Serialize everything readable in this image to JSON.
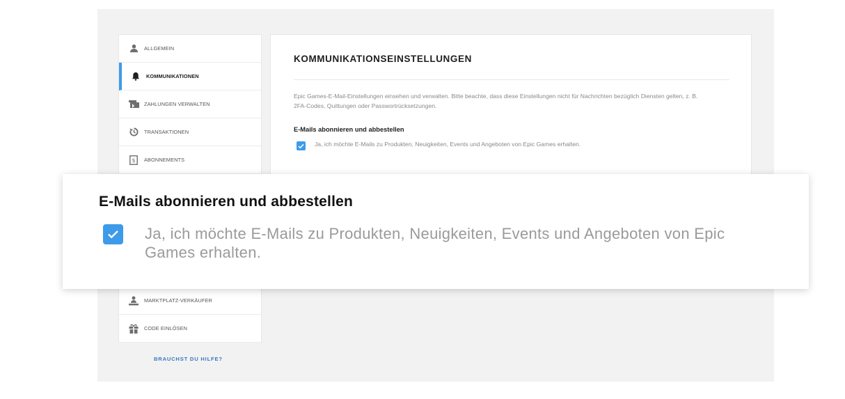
{
  "sidebar": {
    "items": [
      {
        "label": "ALLGEMEIN",
        "icon": "user-icon"
      },
      {
        "label": "KOMMUNIKATIONEN",
        "icon": "bell-icon",
        "active": true
      },
      {
        "label": "ZAHLUNGEN VERWALTEN",
        "icon": "wallet-icon"
      },
      {
        "label": "TRANSAKTIONEN",
        "icon": "history-icon"
      },
      {
        "label": "ABONNEMENTS",
        "icon": "receipt-icon"
      },
      {
        "label": "MARKTPLATZ-VERKÄUFER",
        "icon": "seller-icon"
      },
      {
        "label": "CODE EINLÖSEN",
        "icon": "gift-icon"
      }
    ],
    "help_link": "BRAUCHST DU HILFE?"
  },
  "main": {
    "title": "KOMMUNIKATIONSEINSTELLUNGEN",
    "description": "Epic Games-E-Mail-Einstellungen einsehen und verwalten. Bitte beachte, dass diese Einstellungen nicht für Nachrichten bezüglich Diensten gelten, z. B. 2FA-Codes, Quittungen oder Passwortrücksetzungen.",
    "subheading": "E-Mails abonnieren und abbestellen",
    "checkbox_label": "Ja, ich möchte E-Mails zu Produkten, Neuigkeiten, Events und Angeboten von Epic Games erhalten.",
    "checkbox_checked": true
  },
  "callout": {
    "title": "E-Mails abonnieren und abbestellen",
    "checkbox_label": "Ja, ich möchte E-Mails zu Produkten, Neuigkeiten, Events und Angeboten von Epic Games erhalten.",
    "checkbox_checked": true
  },
  "colors": {
    "accent": "#3d9be9",
    "link": "#3a77c5",
    "background": "#f2f2f2"
  }
}
